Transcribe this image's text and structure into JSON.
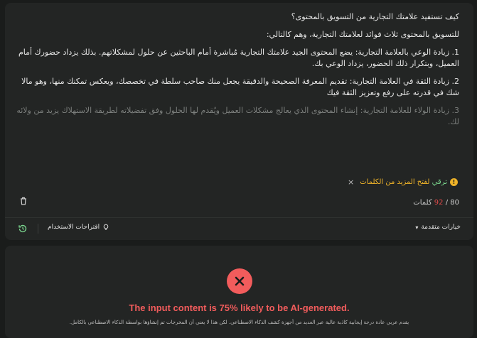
{
  "editor": {
    "paragraphs": [
      "كيف تستفيد علامتك التجارية من التسويق بالمحتوى؟",
      "للتسويق بالمحتوى ثلاث فوائد لعلامتك التجارية، وهم كالتالي:",
      "1. زيادة الوعي بالعلامة التجارية: يضع المحتوى الجيد علامتك التجارية مُباشرة أمام الباحثين عن حلول لمشكلاتهم. بذلك يزداد حضورك أمام العميل، وبتكرار ذلك الحضور، يزداد الوعي بك.",
      "2. زيادة الثقة في العلامة التجارية: تقديم المعرفة الصحيحة والدقيقة يجعل منك صاحب سلطة في تخصصك، ويعكس تمكنك منها، وهو مالا شك في قدرته على رفع وتعزيز الثقة فيك",
      "3. زيادة الولاء للعلامة التجارية: إنشاء المحتوى الذي يعالج مشكلات العميل ويُقدم لها الحلول وفق تفضيلاته لطريقة الاستهلاك يزيد من ولائه لك."
    ],
    "unlock": {
      "green_prefix": "ترقي",
      "rest": " لفتح المزيد من الكلمات",
      "icon": "exclamation-icon",
      "close": "×"
    },
    "word_count": {
      "current": "80",
      "separator": " / ",
      "limit": "92",
      "unit": "كلمات"
    },
    "advanced_options": "خيارات متقدمة",
    "usage_suggestions": "اقتراحات الاستخدام"
  },
  "result": {
    "title": "The input content is 75% likely to be AI-generated.",
    "subtitle": "يقدم عربي عادة درجة إيجابية كاذبة عالية عبر العديد من أجهزة كشف الذكاء الاصطناعي. لكن هذا لا يعني أن المخرجات تم إنشاؤها بواسطة الذكاء الاصطناعي بالكامل.",
    "icon": "x-circle-icon"
  },
  "colors": {
    "background": "#1a1c1b",
    "card": "#232524",
    "error_red": "#f25c5c",
    "upgrade_amber": "#f0b429",
    "upgrade_green": "#7bd88f"
  }
}
